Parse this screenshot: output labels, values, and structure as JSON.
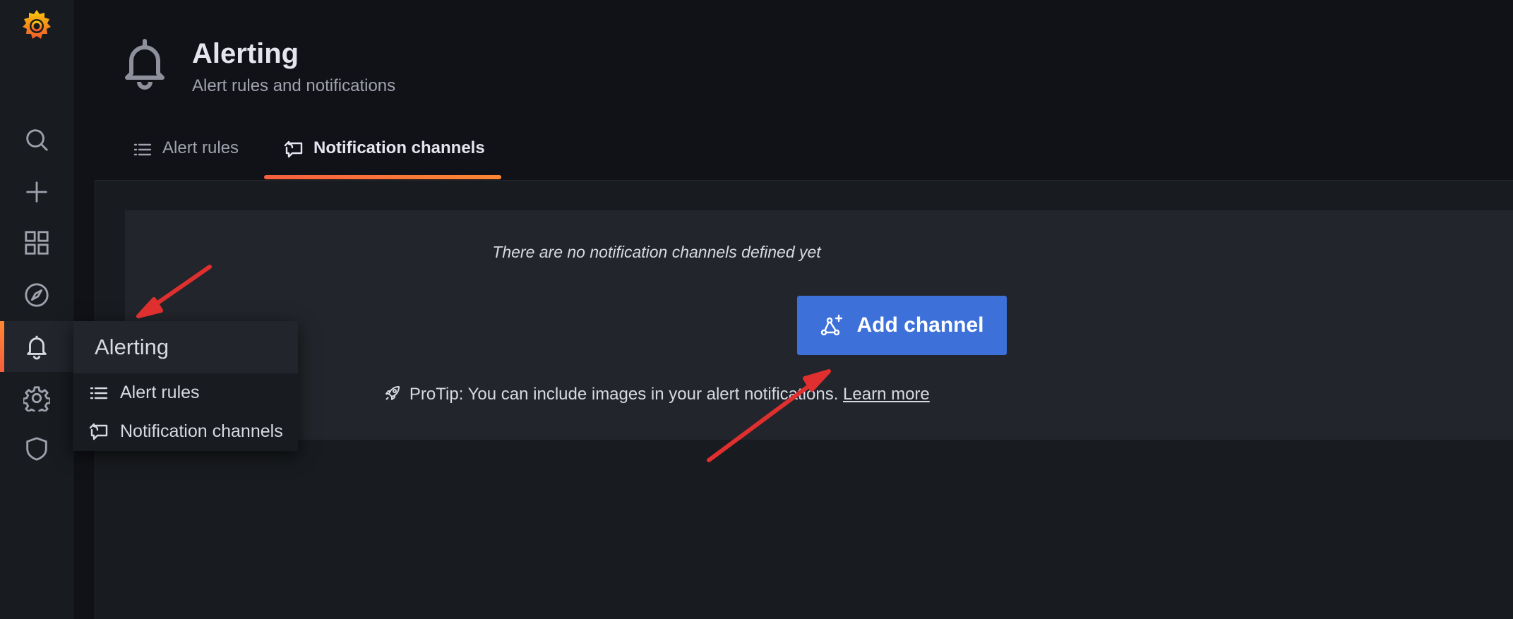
{
  "header": {
    "icon": "bell-icon",
    "title": "Alerting",
    "subtitle": "Alert rules and notifications"
  },
  "tabs": [
    {
      "label": "Alert rules",
      "icon": "list-icon",
      "active": false
    },
    {
      "label": "Notification channels",
      "icon": "comment-alt-share-icon",
      "active": true
    }
  ],
  "sidebar": {
    "logo": "grafana-logo",
    "items": [
      {
        "icon": "search-icon"
      },
      {
        "icon": "plus-icon"
      },
      {
        "icon": "apps-grid-icon"
      },
      {
        "icon": "compass-icon"
      },
      {
        "icon": "bell-icon",
        "active": true
      },
      {
        "icon": "cog-icon"
      },
      {
        "icon": "shield-icon"
      }
    ]
  },
  "flyout": {
    "title": "Alerting",
    "items": [
      {
        "label": "Alert rules",
        "icon": "list-icon"
      },
      {
        "label": "Notification channels",
        "icon": "comment-alt-share-icon"
      }
    ]
  },
  "empty_state": {
    "message": "There are no notification channels defined yet",
    "button_label": "Add channel",
    "button_icon": "channel-add-icon",
    "protip_text": "ProTip: You can include images in your alert notifications.",
    "protip_icon": "rocket-icon",
    "learn_more": "Learn more"
  },
  "colors": {
    "accent_orange": "#ff8833",
    "button_blue": "#3d71d9",
    "annotation_red": "#e02f2f"
  }
}
